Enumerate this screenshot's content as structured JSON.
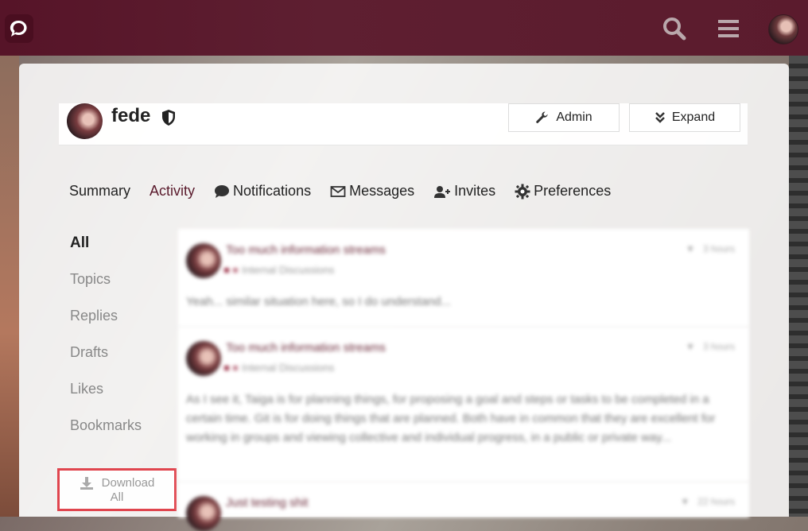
{
  "profile": {
    "username": "fede",
    "admin_label": "Admin",
    "expand_label": "Expand"
  },
  "nav": {
    "summary": "Summary",
    "activity": "Activity",
    "notifications": "Notifications",
    "messages": "Messages",
    "invites": "Invites",
    "preferences": "Preferences"
  },
  "sidebar": {
    "all": "All",
    "topics": "Topics",
    "replies": "Replies",
    "drafts": "Drafts",
    "likes": "Likes",
    "bookmarks": "Bookmarks",
    "download_line1": "Download",
    "download_line2": "All"
  },
  "posts": [
    {
      "title": "Too much information streams",
      "category": "Internal Discussions",
      "time": "3 hours",
      "excerpt": "Yeah... similar situation here, so I do understand..."
    },
    {
      "title": "Too much information streams",
      "category": "Internal Discussions",
      "time": "3 hours",
      "excerpt": "As I see it, Taiga is for planning things, for proposing a goal and steps or tasks to be completed in a certain time. Git is for doing things that are planned. Both have in common that they are excellent for working in groups and viewing collective and individual progress, in a public or private way..."
    },
    {
      "title": "Just testing shit",
      "time": "22 hours"
    }
  ],
  "colors": {
    "header": "#5a1a2c",
    "accent": "#5a1a2c",
    "highlight_border": "#e0454e"
  },
  "icons": {
    "logo": "chat-bubble-icon",
    "search": "search-icon",
    "menu": "hamburger-menu-icon",
    "admin": "wrench-icon",
    "expand": "double-chevron-down-icon",
    "notifications": "comment-icon",
    "messages": "envelope-icon",
    "invites": "user-plus-icon",
    "preferences": "gear-icon",
    "download": "download-icon",
    "moderator": "shield-icon"
  }
}
